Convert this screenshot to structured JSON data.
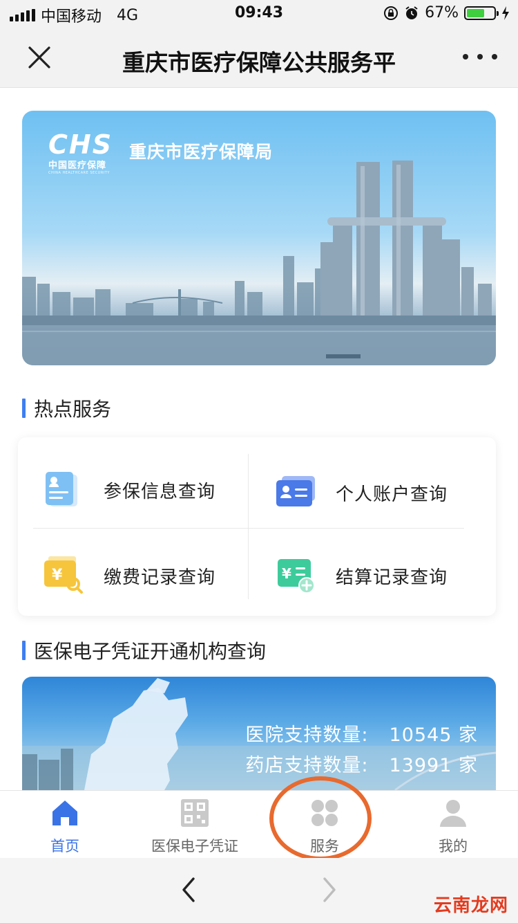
{
  "status_bar": {
    "carrier": "中国移动",
    "network": "4G",
    "time": "09:43",
    "battery_percent": "67%",
    "battery_level": 0.67
  },
  "nav": {
    "title": "重庆市医疗保障公共服务平",
    "close_icon": "close-icon",
    "more_icon": "more-icon"
  },
  "banner": {
    "logo_mark": "CHS",
    "logo_cn": "中国医疗保障",
    "logo_en": "CHINA HEALTHCARE SECURITY",
    "org_name": "重庆市医疗保障局"
  },
  "hot_services": {
    "title": "热点服务",
    "items": [
      {
        "label": "参保信息查询",
        "icon": "insurance-info-icon"
      },
      {
        "label": "个人账户查询",
        "icon": "personal-account-icon"
      },
      {
        "label": "缴费记录查询",
        "icon": "payment-record-icon"
      },
      {
        "label": "结算记录查询",
        "icon": "settlement-record-icon"
      }
    ]
  },
  "institution_query": {
    "title": "医保电子凭证开通机构查询",
    "hospital_label": "医院支持数量:",
    "hospital_count": "10545 家",
    "pharmacy_label": "药店支持数量:",
    "pharmacy_count": "13991 家"
  },
  "tabbar": {
    "items": [
      {
        "label": "首页",
        "icon": "home-icon",
        "active": true
      },
      {
        "label": "医保电子凭证",
        "icon": "qr-code-icon",
        "active": false
      },
      {
        "label": "服务",
        "icon": "services-grid-icon",
        "active": false
      },
      {
        "label": "我的",
        "icon": "profile-icon",
        "active": false
      }
    ]
  },
  "browser_bar": {
    "back_icon": "back-arrow-icon",
    "forward_icon": "forward-arrow-icon"
  },
  "watermark": "云南龙网",
  "colors": {
    "accent": "#3a73e6",
    "highlight_circle": "#e86a2e",
    "watermark": "#e33b1f"
  }
}
